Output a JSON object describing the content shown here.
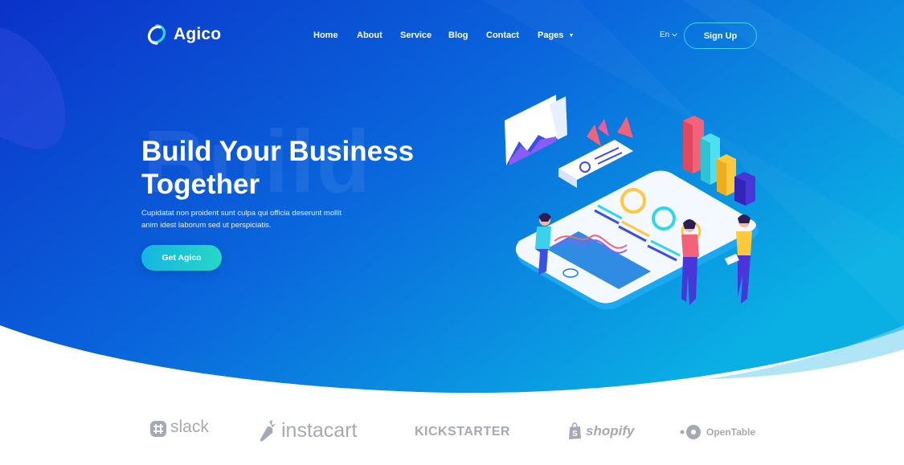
{
  "brand": {
    "name": "Agico"
  },
  "nav": {
    "items": [
      "Home",
      "About",
      "Service",
      "Blog",
      "Contact",
      "Pages"
    ],
    "language": "En",
    "signup_label": "Sign Up"
  },
  "hero": {
    "ghost_word": "Build",
    "headline_line1": "Build Your Business",
    "headline_line2": "Together",
    "subtext": "Cupidatat non proident sunt culpa qui officia deserunt mollit anim idest laborum sed ut perspiciatis.",
    "cta_label": "Get Agico"
  },
  "partners": [
    "slack",
    "instacart",
    "KICKSTARTER",
    "shopify",
    "OpenTable"
  ],
  "colors": {
    "hero_start": "#0a3bd1",
    "hero_end": "#0aa3e0",
    "accent": "#27d7c5",
    "logo_gray": "#a4a9b3"
  }
}
